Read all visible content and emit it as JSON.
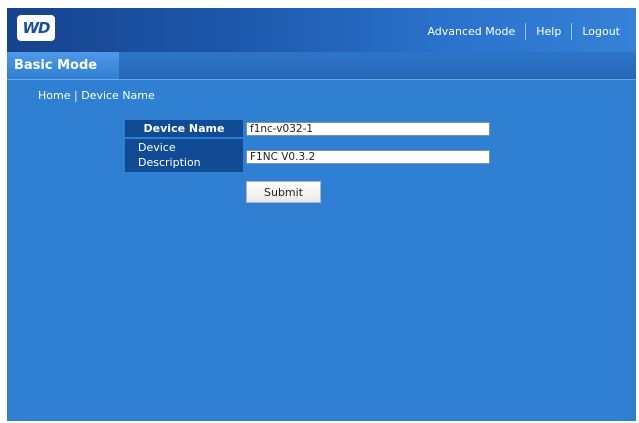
{
  "header": {
    "logo_text": "WD",
    "nav": {
      "advanced_mode": "Advanced Mode",
      "help": "Help",
      "logout": "Logout"
    }
  },
  "tabs": {
    "active": "Basic Mode"
  },
  "breadcrumb": {
    "home": "Home",
    "separator": "|",
    "current": "Device Name"
  },
  "form": {
    "device_name_label": "Device Name",
    "device_name_value": "f1nc-v032-1",
    "device_description_label_line1": "Device",
    "device_description_label_line2": "Description",
    "device_description_value": "F1NC V0.3.2",
    "submit_label": "Submit"
  },
  "colors": {
    "background": "#2f7fd2",
    "header_dark": "#16438d",
    "label_cell": "#104b94"
  }
}
